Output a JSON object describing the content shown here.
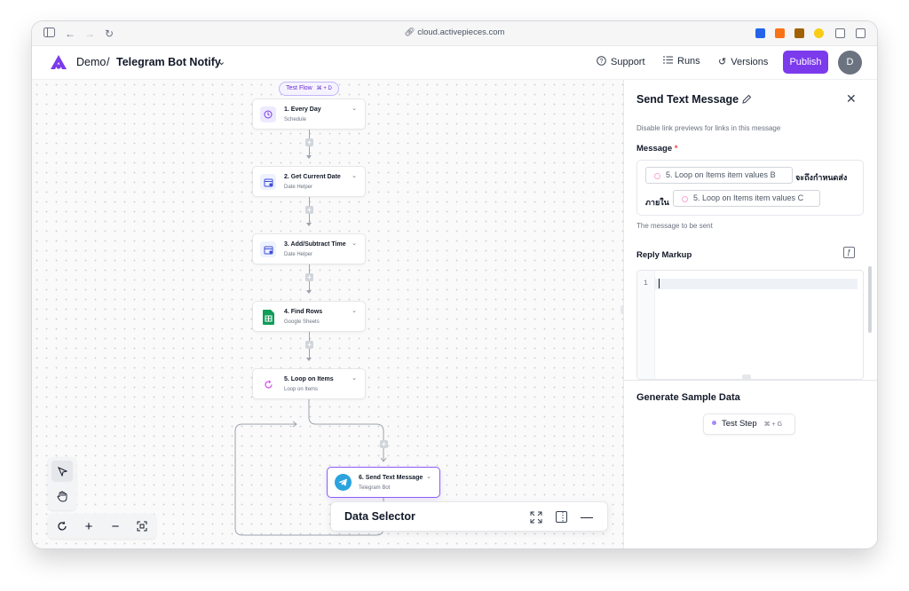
{
  "browser": {
    "url": "cloud.activepieces.com"
  },
  "header": {
    "project": "Demo",
    "separator": "/",
    "flow_name": "Telegram Bot Notify",
    "support_label": "Support",
    "runs_label": "Runs",
    "versions_label": "Versions",
    "publish_label": "Publish",
    "avatar_initial": "D",
    "brand_color": "#7c3aed"
  },
  "canvas": {
    "test_flow_label": "Test Flow",
    "test_flow_shortcut": "⌘ + D",
    "steps": [
      {
        "title": "1. Every Day",
        "subtitle": "Schedule",
        "icon": "schedule-icon"
      },
      {
        "title": "2. Get Current Date",
        "subtitle": "Date Helper",
        "icon": "calendar-icon"
      },
      {
        "title": "3. Add/Subtract Time",
        "subtitle": "Date Helper",
        "icon": "calendar-icon"
      },
      {
        "title": "4. Find Rows",
        "subtitle": "Google Sheets",
        "icon": "google-sheets-icon"
      },
      {
        "title": "5. Loop on Items",
        "subtitle": "Loop on Items",
        "icon": "loop-icon"
      },
      {
        "title": "6. Send Text Message",
        "subtitle": "Telegram Bot",
        "icon": "telegram-icon"
      }
    ],
    "data_selector_title": "Data Selector"
  },
  "panel": {
    "title": "Send Text Message",
    "description": "Disable link previews for links in this message",
    "message_label": "Message",
    "required_mark": "*",
    "chip1": "5. Loop on Items item values B",
    "thai_text1": "จะถึงกำหนดส่ง",
    "thai_text2": "ภายใน",
    "chip2": "5. Loop on Items item values C",
    "message_help": "The message to be sent",
    "reply_markup_label": "Reply Markup",
    "code_line_number": "1",
    "generate_title": "Generate Sample Data",
    "test_step_label": "Test Step",
    "test_step_shortcut": "⌘ + G"
  }
}
